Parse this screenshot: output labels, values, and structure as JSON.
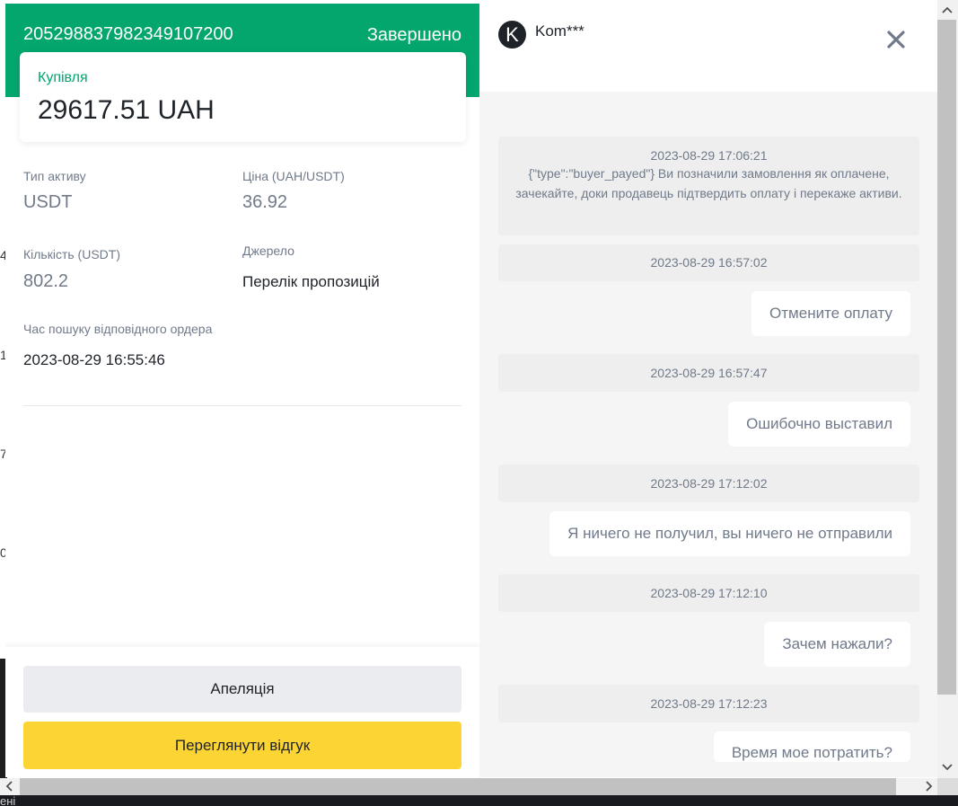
{
  "background": {
    "fragments": [
      "4",
      "1",
      "7",
      "0",
      "ені"
    ]
  },
  "order": {
    "id": "205298837982349107200",
    "status": "Завершено",
    "trade_type": "Купівля",
    "amount": "29617.51 UAH",
    "fields": {
      "asset_type_label": "Тип активу",
      "asset_type_value": "USDT",
      "price_label": "Ціна (UAH/USDT)",
      "price_value": "36.92",
      "quantity_label": "Кількість (USDT)",
      "quantity_value": "802.2",
      "source_label": "Джерело",
      "source_value": "Перелік пропозицій",
      "match_time_label": "Час пошуку відповідного ордера",
      "match_time_value": "2023-08-29 16:55:46"
    },
    "actions": {
      "appeal_label": "Апеляція",
      "review_label": "Переглянути відгук"
    }
  },
  "chat": {
    "avatar_letter": "K",
    "contact_name": "Kom***",
    "close_glyph": "✕",
    "messages": [
      {
        "time": "2023-08-29 17:06:21",
        "text": "{\"type\":\"buyer_payed\"} Ви позначили замовлення як оплачене, зачекайте, доки продавець підтвердить оплату і перекаже активи."
      },
      {
        "time": "2023-08-29 16:57:02",
        "text": "Отмените оплату"
      },
      {
        "time": "2023-08-29 16:57:47",
        "text": "Ошибочно выставил"
      },
      {
        "time": "2023-08-29 17:12:02",
        "text": "Я ничего не получил, вы ничего не отправили"
      },
      {
        "time": "2023-08-29 17:12:10",
        "text": "Зачем нажали?"
      },
      {
        "time": "2023-08-29 17:12:23",
        "text": "Время мое потратить?"
      }
    ]
  },
  "colors": {
    "brand_green": "#03a66d",
    "yellow_button": "#fcd535",
    "grey_button": "#eaecef"
  }
}
